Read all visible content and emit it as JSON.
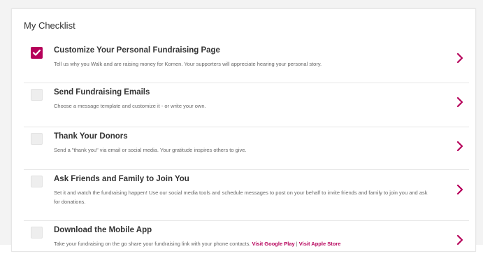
{
  "checklist": {
    "title": "My Checklist",
    "accent_color": "#b6005a",
    "items": [
      {
        "title": "Customize Your Personal Fundraising Page",
        "description": "Tell us why you Walk and are raising money for Komen. Your supporters will appreciate hearing your personal story.",
        "checked": true
      },
      {
        "title": "Send Fundraising Emails",
        "description": "Choose a message template and customize it - or write your own.",
        "checked": false
      },
      {
        "title": "Thank Your Donors",
        "description": "Send a \"thank you\" via email or social media. Your gratitude inspires others to give.",
        "checked": false
      },
      {
        "title": "Ask Friends and Family to Join You",
        "description": "Set it and watch the fundraising happen! Use our social media tools and schedule messages to post on your behalf to invite friends and family to join you and ask for donations.",
        "checked": false
      },
      {
        "title": "Download the Mobile App",
        "description": "Take your fundraising on the go share your fundraising link with your phone contacts.",
        "link_google": "Visit Google Play",
        "link_separator": " | ",
        "link_apple": "Visit Apple Store",
        "checked": false
      }
    ]
  }
}
